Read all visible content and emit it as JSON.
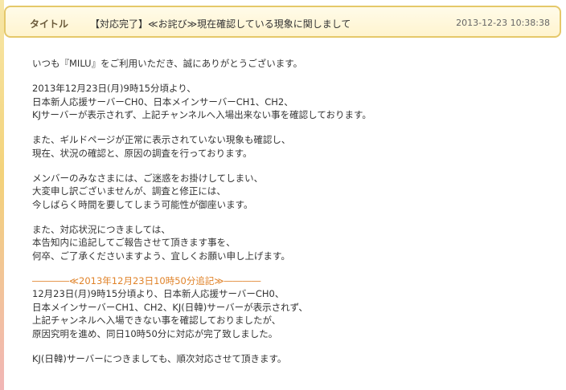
{
  "header": {
    "label": "タイトル",
    "title": "【対応完了】≪お詫び≫現在確認している現象に関しまして",
    "date": "2013-12-23 10:38:38"
  },
  "paragraphs": [
    [
      "いつも『MILU』をご利用いただき、誠にありがとうございます。"
    ],
    [
      "2013年12月23日(月)9時15分頃より、",
      "日本新人応援サーバーCH0、日本メインサーバーCH1、CH2、",
      "KJサーバーが表示されず、上記チャンネルへ入場出来ない事を確認しております。"
    ],
    [
      "また、ギルドページが正常に表示されていない現象も確認し、",
      "現在、状況の確認と、原因の調査を行っております。"
    ],
    [
      "メンバーのみなさまには、ご迷惑をお掛けしてしまい、",
      "大変申し訳ございませんが、調査と修正には、",
      "今しばらく時間を要してしまう可能性が御座います。"
    ],
    [
      "また、対応状況につきましては、",
      "本告知内に追記してご報告させて頂きます事を、",
      "何卒、ご了承くださいますよう、宜しくお願い申し上げます。"
    ]
  ],
  "addendum": {
    "heading": "――――≪2013年12月23日10時50分追記≫――――",
    "lines": [
      "12月23日(月)9時15分頃より、日本新人応援サーバーCH0、",
      "日本メインサーバーCH1、CH2、KJ(日韓)サーバーが表示されず、",
      "上記チャンネルへ入場できない事を確認しておりましたが、",
      "原因究明を進め、同日10時50分に対応が完了致しました。"
    ],
    "closing": "KJ(日韓)サーバーにつきましても、順次対応させて頂きます。"
  }
}
